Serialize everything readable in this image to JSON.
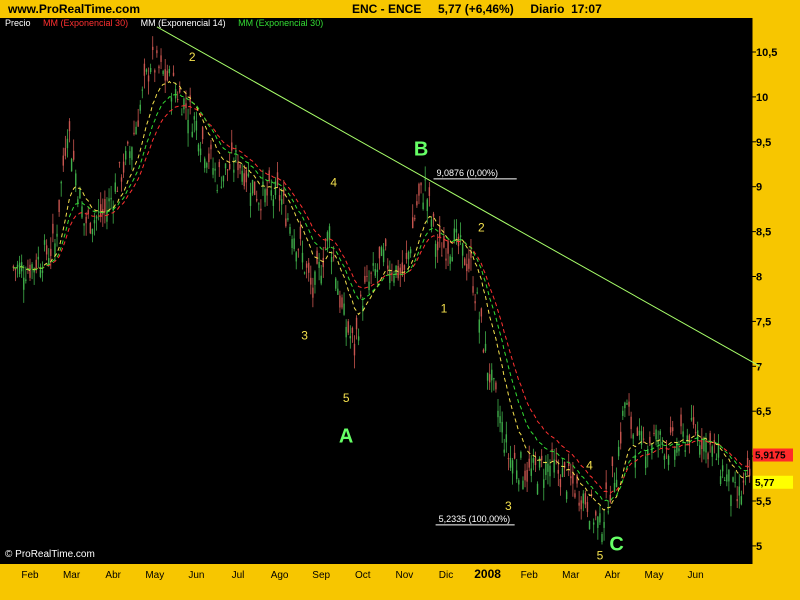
{
  "header": {
    "site": "www.ProRealTime.com",
    "title": "ENC - ENCE     5,77 (+6,46%)     Diario  17:07"
  },
  "legend": {
    "items": [
      {
        "label": "Precio",
        "color": "#ffffff"
      },
      {
        "label": "MM (Exponencial 30)",
        "color": "#ff3030"
      },
      {
        "label": "MM (Exponencial 14)",
        "color": "#ffffff"
      },
      {
        "label": "MM (Exponencial 30)",
        "color": "#33dd33"
      }
    ]
  },
  "footer": {
    "credit": "© ProRealTime.com"
  },
  "colors": {
    "frame": "#f7c600",
    "plot_bg": "#000000",
    "price_up": "#3fae4a",
    "price_down": "#c8554f",
    "ma_red": "#ff3030",
    "ma_yellow": "#f4e04d",
    "ma_green": "#33dd33",
    "trendline": "#a8ff6a",
    "wave_label": "#f4e04d",
    "abc_label": "#66ff66",
    "last_price_bg": "#ffff00",
    "ref_price_bg": "#ff2a2a"
  },
  "chart_data": {
    "type": "candlestick",
    "title": "ENC - ENCE  5,77 (+6,46%)  Diario  17:07",
    "x_tick_labels": [
      "Feb",
      "Mar",
      "Abr",
      "May",
      "Jun",
      "Jul",
      "Ago",
      "Sep",
      "Oct",
      "Nov",
      "Dic",
      "2008",
      "Feb",
      "Mar",
      "Abr",
      "May",
      "Jun"
    ],
    "y_tick_labels": [
      "5",
      "5,5",
      "6",
      "6,5",
      "7",
      "7,5",
      "8",
      "8,5",
      "9",
      "9,5",
      "10",
      "10,5"
    ],
    "ylim": [
      4.8,
      10.85
    ],
    "series": [
      {
        "name": "Precio",
        "x": [
          0,
          1,
          2,
          3,
          4,
          5,
          6,
          7,
          8,
          9,
          10,
          11,
          12,
          13,
          14,
          15,
          16,
          17
        ],
        "values": [
          8.1,
          8.3,
          9.0,
          9.0,
          10.5,
          10.0,
          9.2,
          9.0,
          8.3,
          7.0,
          8.0,
          9.05,
          8.3,
          6.0,
          5.9,
          5.3,
          6.2,
          6.1
        ]
      },
      {
        "name": "MM (Exponencial 30)",
        "color": "red"
      },
      {
        "name": "MM (Exponencial 14)",
        "color": "yellow"
      },
      {
        "name": "MM (Exponencial 30)",
        "color": "green"
      }
    ],
    "fib_levels": [
      {
        "value": 9.0876,
        "label": "9,0876 (0,00%)"
      },
      {
        "value": 5.2335,
        "label": "5,2335 (100,00%)"
      }
    ],
    "trendline": {
      "from": {
        "x": 3.05,
        "y": 10.78
      },
      "to": {
        "x": 17.55,
        "y": 7.0
      }
    },
    "wave_labels": [
      {
        "text": "2",
        "x": 3.9,
        "y": 10.4,
        "size": "small"
      },
      {
        "text": "4",
        "x": 7.3,
        "y": 9.0,
        "size": "small"
      },
      {
        "text": "3",
        "x": 6.6,
        "y": 7.3,
        "size": "small"
      },
      {
        "text": "5",
        "x": 7.6,
        "y": 6.6,
        "size": "small"
      },
      {
        "text": "A",
        "x": 7.6,
        "y": 6.15,
        "size": "large"
      },
      {
        "text": "B",
        "x": 9.4,
        "y": 9.35,
        "size": "large"
      },
      {
        "text": "2",
        "x": 10.85,
        "y": 8.5,
        "size": "small"
      },
      {
        "text": "1",
        "x": 9.95,
        "y": 7.6,
        "size": "small"
      },
      {
        "text": "3",
        "x": 11.5,
        "y": 5.4,
        "size": "small"
      },
      {
        "text": "4",
        "x": 13.45,
        "y": 5.85,
        "size": "small"
      },
      {
        "text": "5",
        "x": 13.7,
        "y": 4.85,
        "size": "small"
      },
      {
        "text": "C",
        "x": 14.1,
        "y": 4.95,
        "size": "large"
      }
    ],
    "last_price_tags": [
      {
        "value": 5.9175,
        "label": "5,9175"
      },
      {
        "value": 5.77,
        "label": "5,77"
      }
    ],
    "grid": false
  }
}
